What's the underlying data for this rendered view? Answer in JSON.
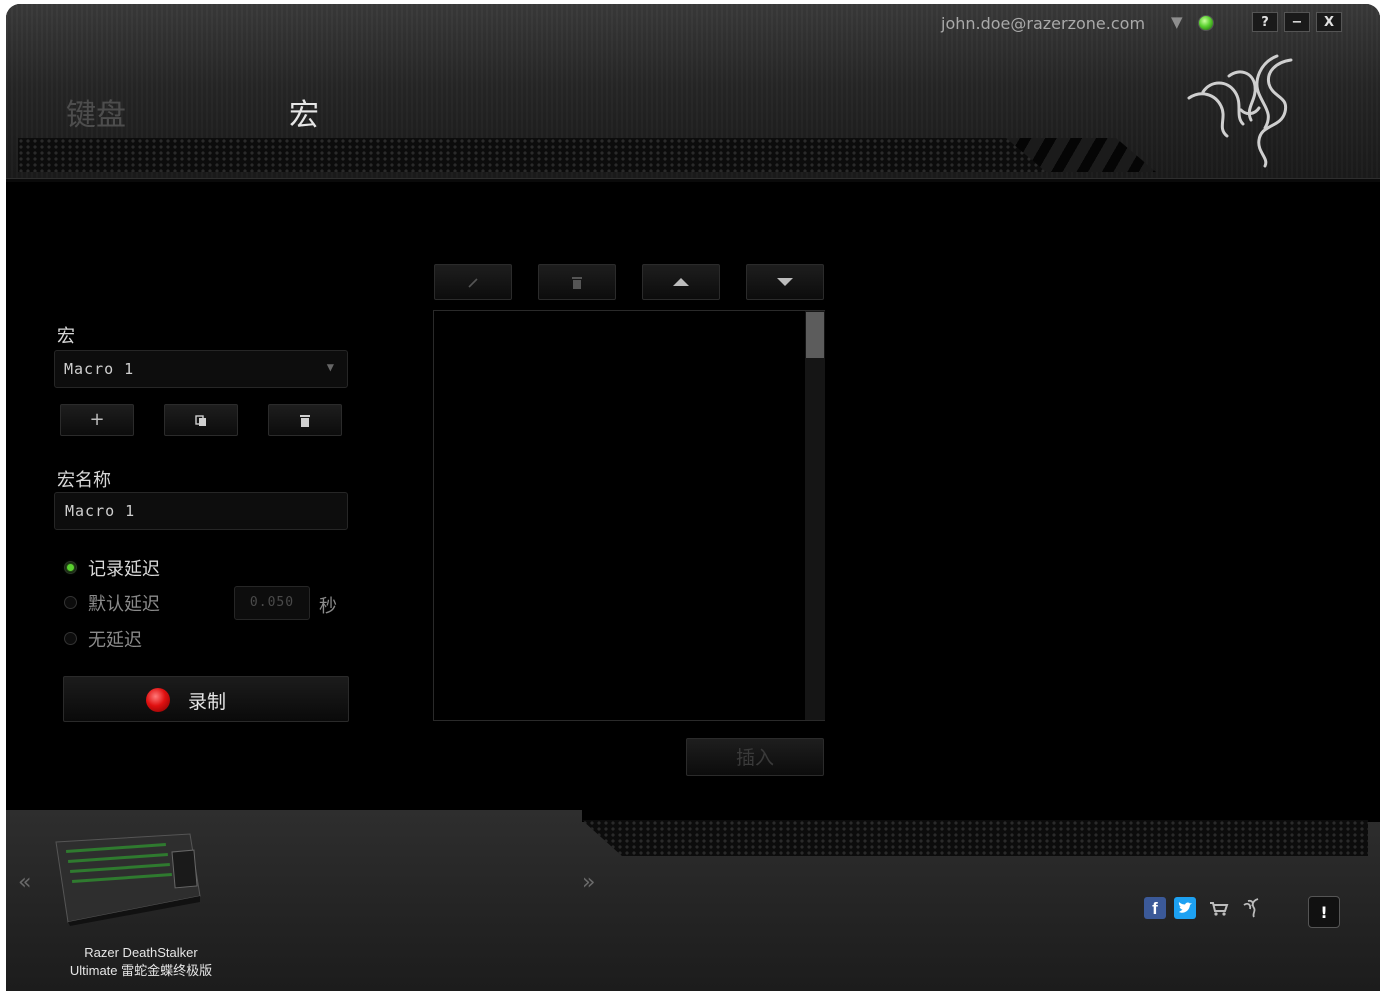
{
  "header": {
    "tabs": [
      {
        "label": "键盘",
        "active": false
      },
      {
        "label": "宏",
        "active": true
      }
    ],
    "account_email": "john.doe@razerzone.com",
    "status_color": "#5ad12f",
    "window_buttons": {
      "help": "?",
      "minimize": "−",
      "close": "X"
    }
  },
  "macro_panel": {
    "macro_label": "宏",
    "macro_select_value": "Macro 1",
    "name_label": "宏名称",
    "name_value": "Macro 1",
    "delay_options": [
      {
        "label": "记录延迟",
        "selected": true
      },
      {
        "label": "默认延迟",
        "selected": false
      },
      {
        "label": "无延迟",
        "selected": false
      }
    ],
    "default_delay_value": "0.050",
    "delay_unit": "秒",
    "record_label": "录制"
  },
  "editor": {
    "insert_label": "插入"
  },
  "footer": {
    "device_name_line1": "Razer DeathStalker",
    "device_name_line2": "Ultimate 雷蛇金蝶终极版",
    "fb_glyph": "f",
    "alert_glyph": "!"
  },
  "colors": {
    "accent_green": "#5ad12f",
    "record_red": "#e01010",
    "background": "#000000"
  }
}
